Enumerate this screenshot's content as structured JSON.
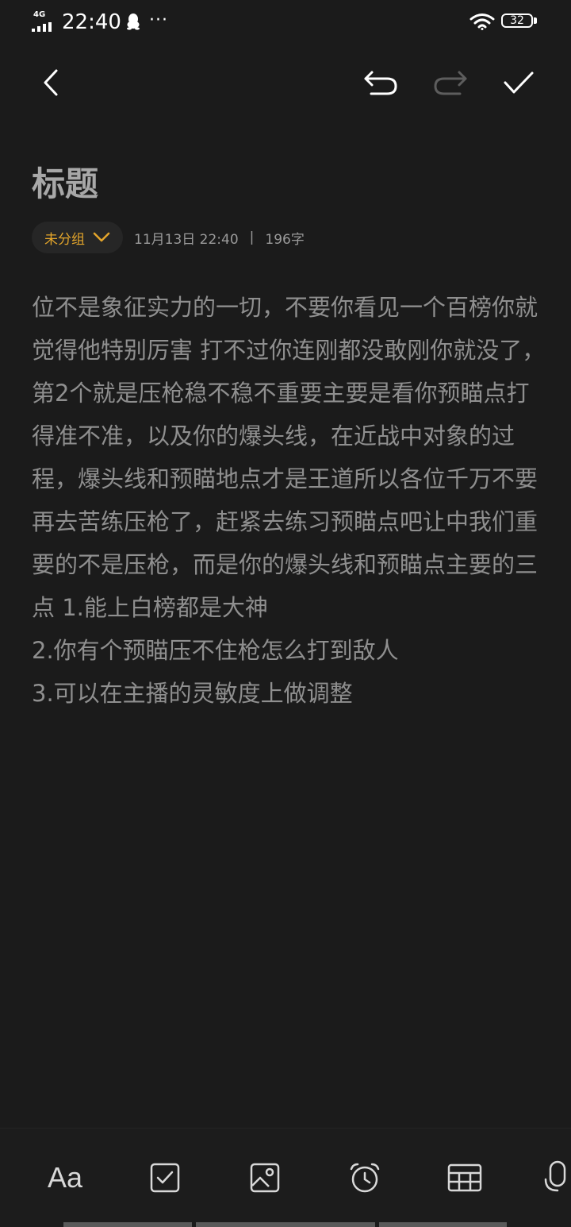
{
  "status_bar": {
    "network": "4G",
    "time": "22:40",
    "more": "···",
    "battery": "32"
  },
  "toolbar": {
    "back_icon": "chevron-left-icon",
    "undo_icon": "undo-icon",
    "redo_icon": "redo-icon",
    "done_icon": "check-icon"
  },
  "note": {
    "title": "标题",
    "group": "未分组",
    "date": "11月13日 22:40",
    "separator": "|",
    "char_count": "196字",
    "body": [
      "位不是象征实力的一切，不要你看见一个百榜你就觉得他特别厉害 打不过你连刚都没敢刚你就没了，第2个就是压枪稳不稳不重要主要是看你预瞄点打得准不准，以及你的爆头线，在近战中对象的过程，爆头线和预瞄地点才是王道所以各位千万不要再去苦练压枪了，赶紧去练习预瞄点吧让中我们重要的不是压枪，而是你的爆头线和预瞄点主要的三点   1.能上白榜都是大神",
      "2.你有个预瞄压不住枪怎么打到敌人",
      "3.可以在主播的灵敏度上做调整"
    ]
  },
  "bottom_toolbar": {
    "font_label": "Aa",
    "icons": [
      "font-icon",
      "checklist-icon",
      "image-icon",
      "alarm-icon",
      "table-icon",
      "mic-icon"
    ]
  },
  "colors": {
    "background": "#1b1b1b",
    "accent": "#e3a52b",
    "body_text": "#8f8f8f",
    "title_text": "#a8a8a8"
  }
}
